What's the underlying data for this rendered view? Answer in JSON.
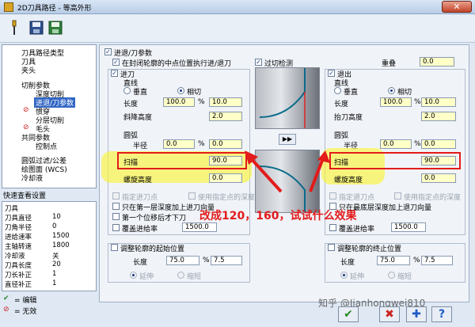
{
  "window": {
    "title": "2D刀具路径 - 等高外形",
    "close": "✕"
  },
  "tree": {
    "items": [
      "刀具路径类型",
      "刀具",
      "夹头",
      "切削参数",
      "深度切削",
      "进退/刀参数",
      "惯穿",
      "分层切削",
      "毛头",
      "共同参数",
      "控制点",
      "圆弧过滤/公差",
      "绘图面 (WCS)",
      "冷却液"
    ]
  },
  "quick": {
    "header": "快速查看设置",
    "rows": [
      {
        "k": "刀具",
        "v": ""
      },
      {
        "k": "刀具直径",
        "v": "10"
      },
      {
        "k": "刀角半径",
        "v": "0"
      },
      {
        "k": "进给速率",
        "v": "1500"
      },
      {
        "k": "主轴转速",
        "v": "1800"
      },
      {
        "k": "冷却液",
        "v": "关"
      },
      {
        "k": "刀具长度",
        "v": "20"
      },
      {
        "k": "刀长补正",
        "v": "1"
      },
      {
        "k": "直径补正",
        "v": "1"
      }
    ]
  },
  "legend": {
    "edit": "= 编辑",
    "disabled": "= 无效"
  },
  "main": {
    "enable_label": "进退/刀参数",
    "center_label": "在封闭轮廓的中点位置执行进/退刀",
    "overlap_check": "过切检测",
    "overlap_label": "重叠",
    "overlap_value": "0.0",
    "entry": {
      "title": "进刀",
      "line_label": "直线",
      "vertical": "垂直",
      "tangent": "相切",
      "length_label": "长度",
      "length_pct": "100.0",
      "length_val": "10.0",
      "ramp_label": "斜降高度",
      "ramp_val": "2.0",
      "arc_label": "圆弧",
      "radius_label": "半径",
      "radius_pct": "0.0",
      "radius_val": "0.0",
      "sweep_label": "扫描",
      "sweep_val": "90.0",
      "helix_label": "螺旋高度",
      "helix_val": "0.0",
      "specify_point": "指定进刀点",
      "use_point_depth": "使用指定点的深度",
      "first_depth": "只在第一层深度加上进刀向量",
      "first_move": "第一个位移后才下刀",
      "override_label": "覆盖进给率",
      "override_val": "1500.0",
      "adjust_label": "调整轮廓的起始位置",
      "adj_len_label": "长度",
      "adj_len_pct": "75.0",
      "adj_len_val": "7.5",
      "extend": "延伸",
      "shorten": "缩短"
    },
    "exit": {
      "title": "退出",
      "line_label": "直线",
      "vertical": "垂直",
      "tangent": "相切",
      "length_label": "长度",
      "length_pct": "100.0",
      "length_val": "10.0",
      "ramp_label": "抬刀高度",
      "ramp_val": "2.0",
      "arc_label": "圆弧",
      "radius_label": "半径",
      "radius_pct": "0.0",
      "radius_val": "0.0",
      "sweep_label": "扫描",
      "sweep_val": "90.0",
      "helix_label": "螺旋高度",
      "helix_val": "0.0",
      "specify_point": "指定退刀点",
      "use_point_depth": "使用指定点的深度",
      "last_depth": "只在最底层深度加上退刀向量",
      "override_label": "覆盖进给率",
      "override_val": "1500.0",
      "adjust_label": "调整轮廓的终止位置",
      "adj_len_label": "长度",
      "adj_len_pct": "75.0",
      "adj_len_val": "7.5",
      "extend": "延伸",
      "shorten": "缩短"
    },
    "pct": "%",
    "copy_btn": "▶▶"
  },
  "annotation": "改成120，160，试试什么效果",
  "watermark": "知乎 @Jianhongwei810",
  "footer": {
    "ok": "✔",
    "cancel": "✖",
    "add": "✚",
    "help": "?"
  }
}
